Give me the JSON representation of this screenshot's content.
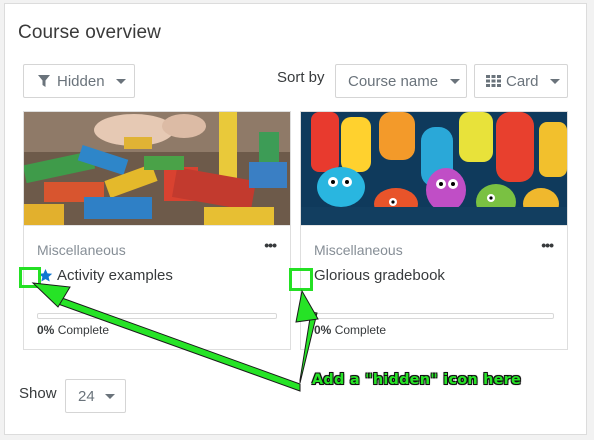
{
  "block": {
    "title": "Course overview"
  },
  "filter": {
    "label": "Hidden",
    "icon": "filter-icon"
  },
  "sort": {
    "label": "Sort by",
    "value": "Course name"
  },
  "view": {
    "label": "Card",
    "icon": "grid-icon"
  },
  "courses": [
    {
      "category": "Miscellaneous",
      "name": "Activity examples",
      "starred": true,
      "progress_value": "0%",
      "progress_suffix": "Complete",
      "progress_fraction": 0,
      "image": "wooden-blocks"
    },
    {
      "category": "Miscellaneous",
      "name": "Glorious gradebook",
      "starred": false,
      "progress_value": "0%",
      "progress_suffix": "Complete",
      "progress_fraction": 0,
      "image": "cartoon-numbers"
    }
  ],
  "pagination": {
    "show_label": "Show",
    "per_page": "24"
  },
  "annotation": {
    "text": "Add a \"hidden\" icon here",
    "color": "#26e326"
  },
  "colors": {
    "accent": "#1177d1",
    "highlight": "#24e024"
  }
}
